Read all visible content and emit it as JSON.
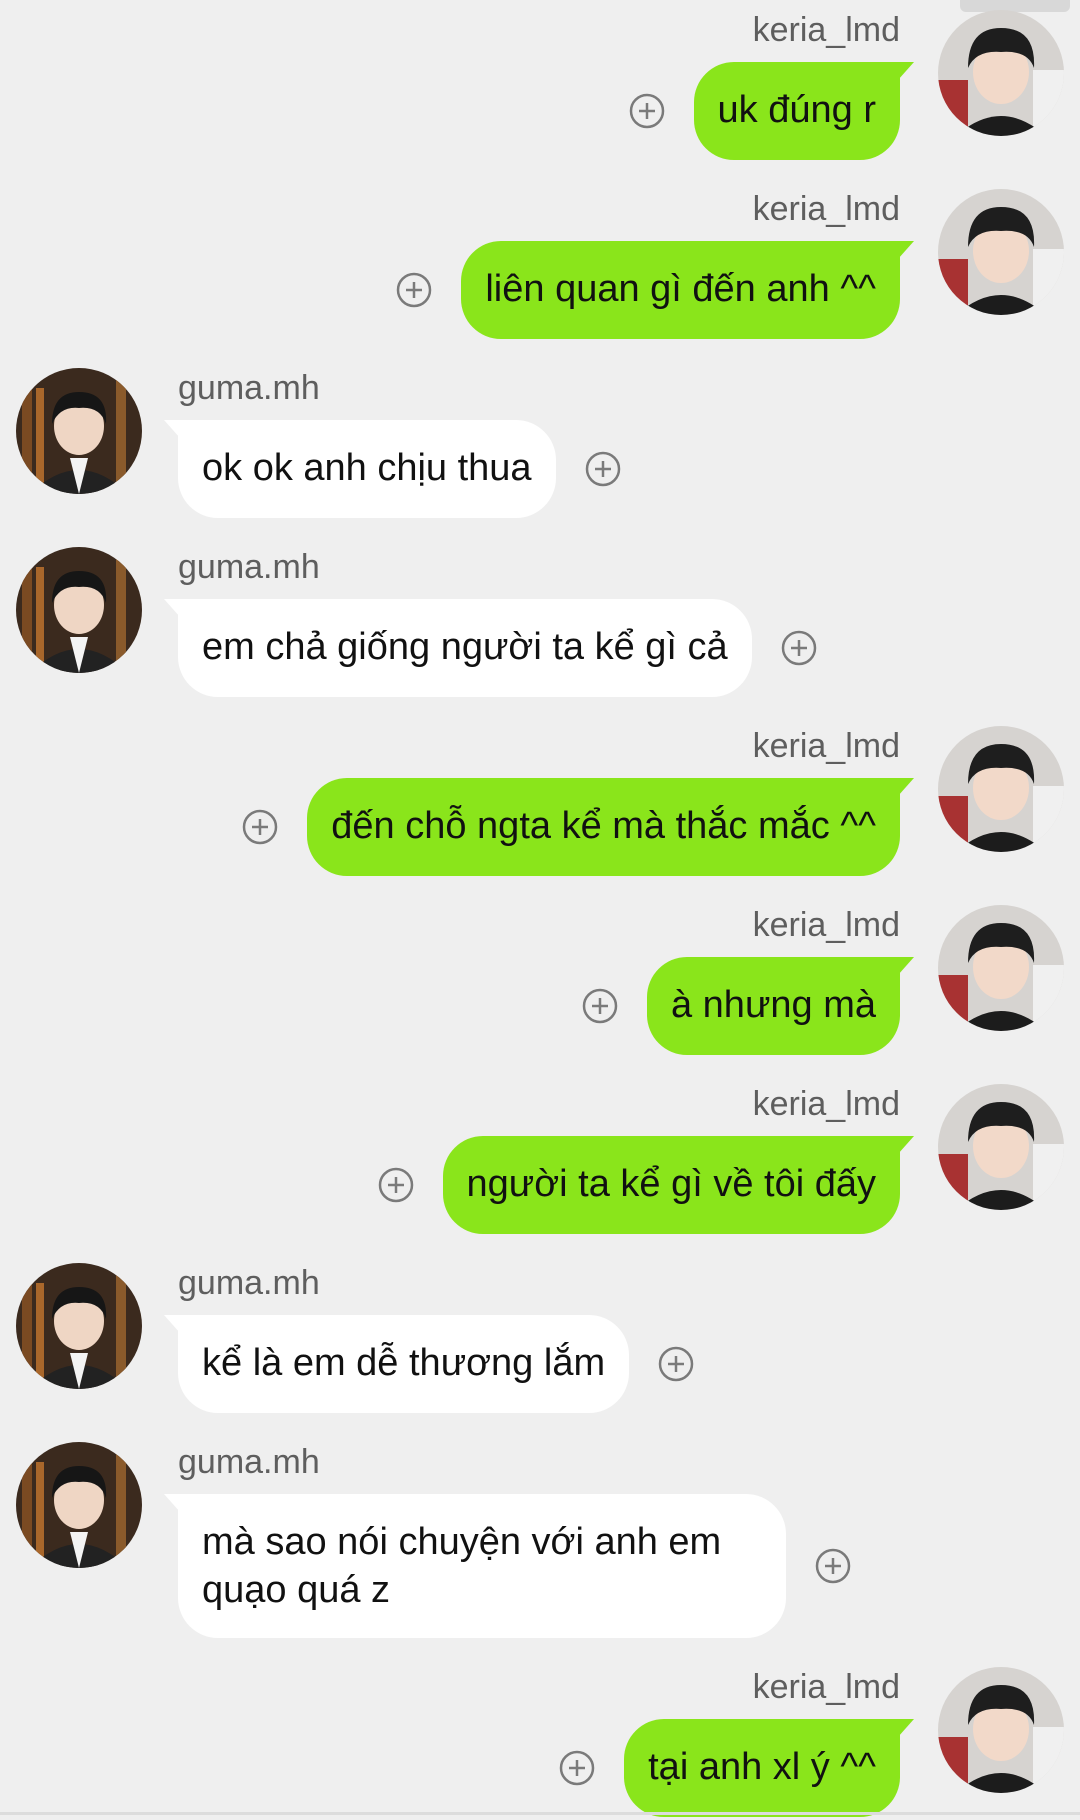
{
  "colors": {
    "background": "#efefef",
    "my_bubble": "#8ae51b",
    "their_bubble": "#ffffff",
    "username": "#5e5e5e",
    "plus_icon": "#7a7a7a"
  },
  "messages": [
    {
      "sender": "keria_lmd",
      "side": "right",
      "text": "uk đúng r"
    },
    {
      "sender": "keria_lmd",
      "side": "right",
      "text": "liên quan gì đến anh ^^"
    },
    {
      "sender": "guma.mh",
      "side": "left",
      "text": "ok ok anh chịu thua"
    },
    {
      "sender": "guma.mh",
      "side": "left",
      "text": "em chả giống người ta kể gì cả"
    },
    {
      "sender": "keria_lmd",
      "side": "right",
      "text": "đến chỗ ngta kể mà thắc mắc ^^"
    },
    {
      "sender": "keria_lmd",
      "side": "right",
      "text": "à nhưng mà"
    },
    {
      "sender": "keria_lmd",
      "side": "right",
      "text": "người ta kể gì về tôi đấy"
    },
    {
      "sender": "guma.mh",
      "side": "left",
      "text": "kể là em dễ thương lắm"
    },
    {
      "sender": "guma.mh",
      "side": "left",
      "text": "mà sao nói chuyện với anh em quạo quá z"
    },
    {
      "sender": "keria_lmd",
      "side": "right",
      "text": "tại anh xl ý ^^"
    }
  ],
  "icons": {
    "add_reaction": "plus-circle-icon",
    "my_avatar": "avatar-keria",
    "their_avatar": "avatar-guma"
  }
}
